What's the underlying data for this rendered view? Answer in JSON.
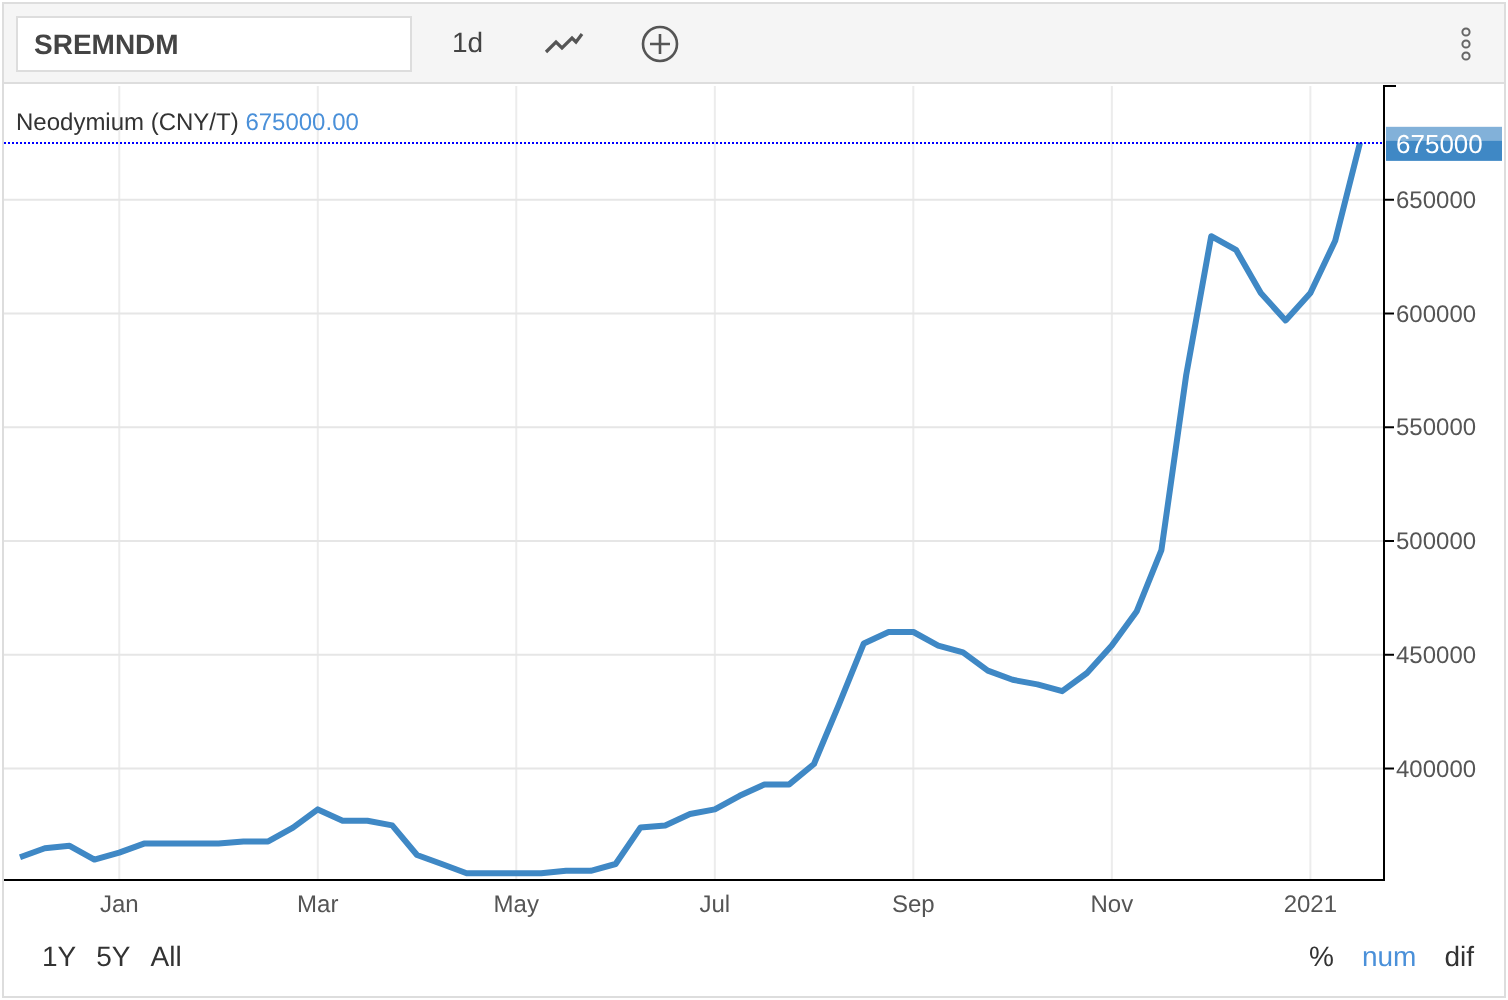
{
  "toolbar": {
    "symbol": "SREMNDM",
    "interval": "1d"
  },
  "legend": {
    "value": "675000.00"
  },
  "price_label": "675000",
  "chart_data": {
    "type": "line",
    "grid": true,
    "ylim": [
      351000,
      700000
    ],
    "ref_lines": [
      {
        "axis": "y",
        "value": 675000,
        "color": "#0000ff"
      }
    ],
    "categories": [
      null,
      null,
      null,
      null,
      "Jan",
      null,
      null,
      null,
      null,
      null,
      null,
      null,
      "Mar",
      null,
      null,
      null,
      null,
      null,
      null,
      null,
      "May",
      null,
      null,
      null,
      null,
      null,
      null,
      null,
      "Jul",
      null,
      null,
      null,
      null,
      null,
      null,
      null,
      "Sep",
      null,
      null,
      null,
      null,
      null,
      null,
      null,
      "Nov",
      null,
      null,
      null,
      null,
      null,
      null,
      null,
      "2021",
      null,
      null
    ],
    "yticks": [
      {
        "value": 400000,
        "label": "400000"
      },
      {
        "value": 450000,
        "label": "450000"
      },
      {
        "value": 500000,
        "label": "500000"
      },
      {
        "value": 550000,
        "label": "550000"
      },
      {
        "value": 600000,
        "label": "600000"
      },
      {
        "value": 650000,
        "label": "650000"
      }
    ],
    "series": [
      {
        "name": "Neodymium (CNY/T)",
        "color": "#3f88c5",
        "values": [
          361000,
          365000,
          366000,
          360000,
          363000,
          367000,
          367000,
          367000,
          367000,
          368000,
          368000,
          374000,
          382000,
          377000,
          377000,
          375000,
          362000,
          358000,
          354000,
          354000,
          354000,
          354000,
          355000,
          355000,
          358000,
          374000,
          375000,
          380000,
          382000,
          388000,
          393000,
          393000,
          402000,
          428000,
          455000,
          460000,
          460000,
          454000,
          451000,
          443000,
          439000,
          437000,
          434000,
          442000,
          454000,
          469000,
          496000,
          573000,
          634000,
          628000,
          609000,
          597000,
          609000,
          632000,
          675000
        ]
      }
    ]
  },
  "range_buttons": [
    {
      "label": "1Y"
    },
    {
      "label": "5Y"
    },
    {
      "label": "All"
    }
  ],
  "modes": [
    {
      "label": "%",
      "selected": false
    },
    {
      "label": "num",
      "selected": true
    },
    {
      "label": "dif",
      "selected": false
    }
  ]
}
